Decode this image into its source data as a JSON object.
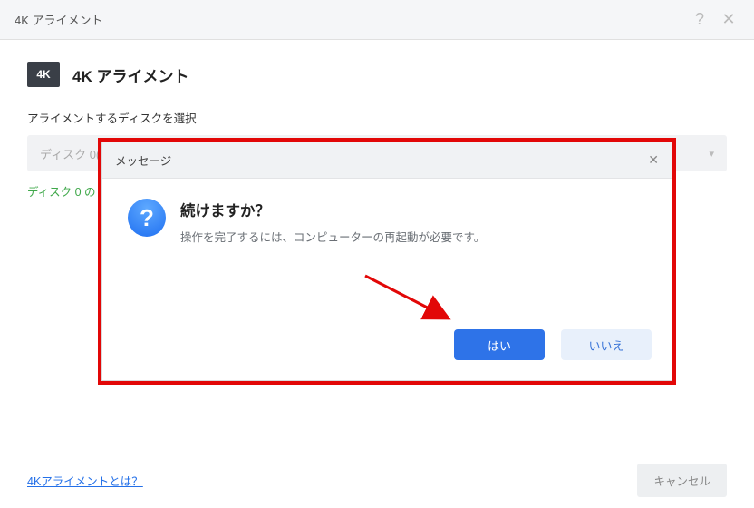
{
  "window": {
    "title": "4K アライメント"
  },
  "page": {
    "badge": "4K",
    "title": "4K アライメント",
    "label_select_disk": "アライメントするディスクを選択",
    "disk_value": "ディスク 0(",
    "status_text": "ディスク 0 の"
  },
  "modal": {
    "header": "メッセージ",
    "title": "続けますか？",
    "body": "操作を完了するには、コンピューターの再起動が必要です。",
    "yes": "はい",
    "no": "いいえ"
  },
  "footer": {
    "help_link": "4Kアライメントとは？",
    "cancel": "キャンセル"
  },
  "colors": {
    "annotation_red": "#e20707",
    "status_green": "#3fa84a",
    "primary_blue": "#2e73e8"
  }
}
